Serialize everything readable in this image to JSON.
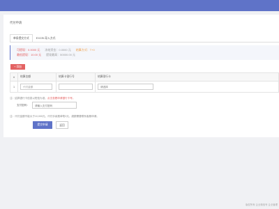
{
  "header": {
    "title": "代付申请"
  },
  "tabs": [
    {
      "label": "单条提交方式",
      "active": true
    },
    {
      "label": "EXCEL导入方式",
      "active": false
    }
  ],
  "balance": {
    "available_label": "可提现：",
    "available_value": "0.0000 元",
    "frozen_label": "冻结资金：",
    "frozen_value": "0.0000 元",
    "fee_method_label": "结算方式：",
    "fee_method_value": "T+0",
    "min_label": "最低提现：",
    "min_value": "10.00 元",
    "max_label": "提现最高：",
    "max_value": "50000.00 元"
  },
  "add_button": "+ 添加",
  "table": {
    "headers": [
      "#",
      "结算金额",
      "结算卡银行号",
      "结算银行卡"
    ],
    "rows": [
      {
        "index": "1",
        "amount_placeholder": "代付金额",
        "card_no": "",
        "bank_placeholder": "请选择"
      }
    ]
  },
  "notes": {
    "note1_prefix": "注：结算银行卡信息以短信为准，",
    "note1_red": "点击查看申请银行卡号。",
    "vcode_label": "支付密码：",
    "vcode_placeholder": "请输入支付密码",
    "note2": "注：代付金额不能大于10,000元，代付手续费单笔3元，超额需要联系客服申请。"
  },
  "actions": {
    "submit": "提交申请",
    "back": "返回"
  },
  "footer": "版权所有 企业微信号 企业管理"
}
